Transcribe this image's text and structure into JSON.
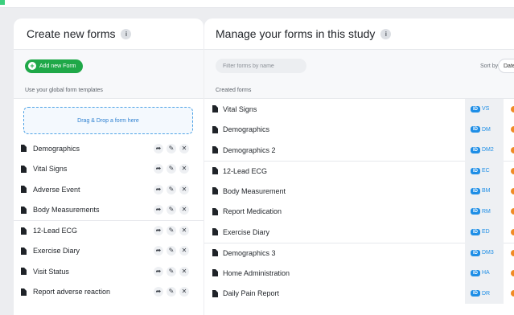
{
  "left": {
    "title": "Create new forms",
    "add_button_label": "Add new Form",
    "section_label": "Use your global form templates",
    "dropzone_text": "Drag & Drop a form here",
    "templates": [
      {
        "label": "Demographics"
      },
      {
        "label": "Vital Signs"
      },
      {
        "label": "Adverse Event"
      },
      {
        "label": "Body Measurements"
      },
      {
        "label": "12-Lead ECG"
      },
      {
        "label": "Exercise Diary"
      },
      {
        "label": "Visit Status"
      },
      {
        "label": "Report adverse reaction"
      }
    ]
  },
  "right": {
    "title": "Manage your forms in this study",
    "filter_placeholder": "Filter forms by name",
    "sort_label": "Sort by:",
    "sort_value": "Date",
    "section_label": "Created forms",
    "id_badge": "ID",
    "forms": [
      {
        "label": "Vital Signs",
        "code": "VS"
      },
      {
        "label": "Demographics",
        "code": "DM"
      },
      {
        "label": "Demographics 2",
        "code": "DM2"
      },
      {
        "label": "12-Lead ECG",
        "code": "EC"
      },
      {
        "label": "Body Measurement",
        "code": "BM"
      },
      {
        "label": "Report Medication",
        "code": "RM"
      },
      {
        "label": "Exercise Diary",
        "code": "ED"
      },
      {
        "label": "Demographics 3",
        "code": "DM3"
      },
      {
        "label": "Home Administration",
        "code": "HA"
      },
      {
        "label": "Daily Pain Report",
        "code": "DR"
      }
    ]
  },
  "colors": {
    "accent_green": "#1fa848",
    "accent_blue": "#1e8ee6",
    "status_orange": "#f08a24"
  }
}
